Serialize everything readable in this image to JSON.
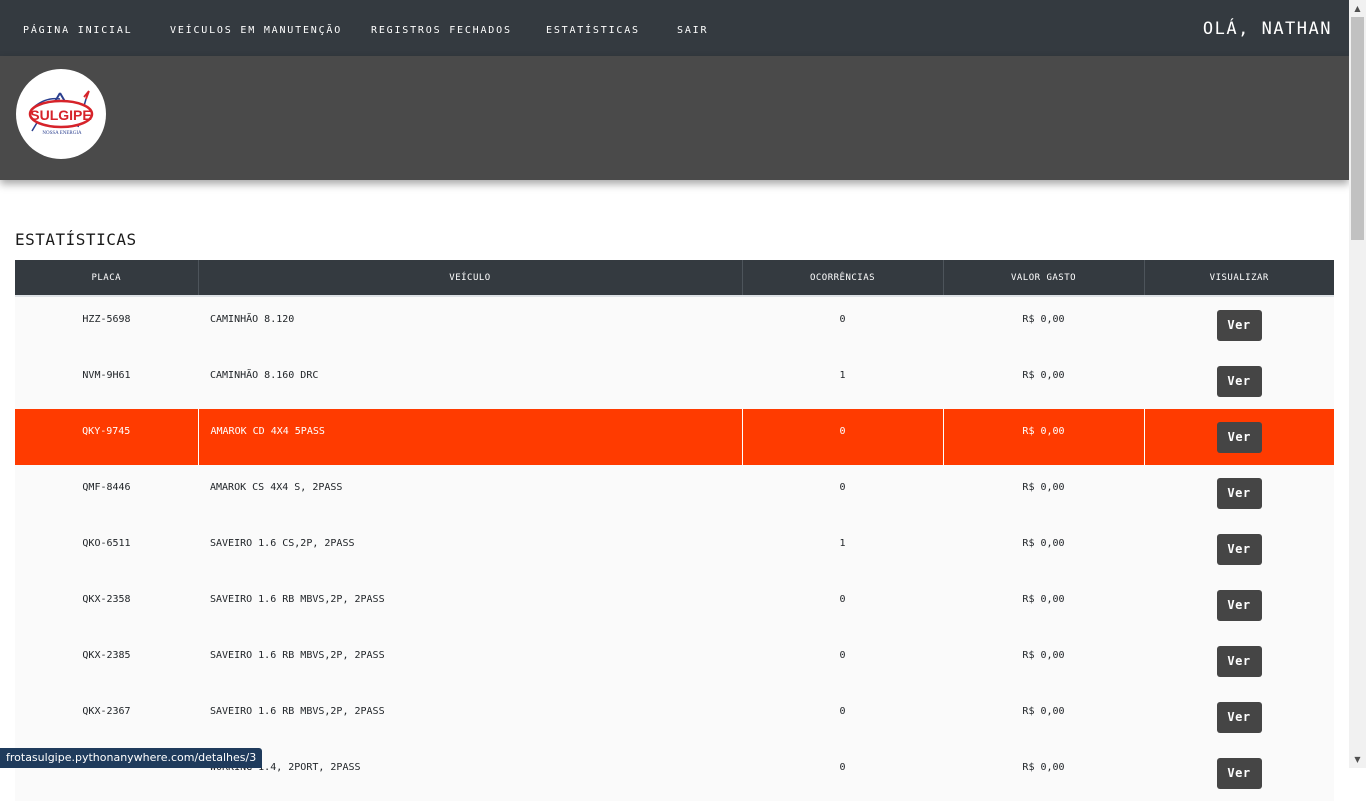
{
  "nav": {
    "items": [
      {
        "label": "PÁGINA INICIAL"
      },
      {
        "label": "VEÍCULOS EM MANUTENÇÃO"
      },
      {
        "label": "REGISTROS FECHADOS"
      },
      {
        "label": "ESTATÍSTICAS"
      },
      {
        "label": "SAIR"
      }
    ],
    "greeting": "OLÁ, NATHAN"
  },
  "logo": {
    "text": "SULGIPE",
    "tagline": "NOSSA ENERGIA",
    "colors": {
      "red": "#d6232a",
      "blue": "#2a3f8f"
    }
  },
  "page": {
    "title": "ESTATÍSTICAS"
  },
  "table": {
    "headers": [
      "PLACA",
      "VEÍCULO",
      "OCORRÊNCIAS",
      "VALOR GASTO",
      "VISUALIZAR"
    ],
    "highlight_color": "#ff3b00",
    "rows": [
      {
        "placa": "HZZ-5698",
        "veiculo": "CAMINHÃO 8.120",
        "ocorrencias": "0",
        "valor": "R$ 0,00",
        "action": "Ver"
      },
      {
        "placa": "NVM-9H61",
        "veiculo": "CAMINHÃO 8.160 DRC",
        "ocorrencias": "1",
        "valor": "R$ 0,00",
        "action": "Ver"
      },
      {
        "placa": "QKY-9745",
        "veiculo": "AMAROK CD 4X4 5PASS",
        "ocorrencias": "0",
        "valor": "R$ 0,00",
        "action": "Ver"
      },
      {
        "placa": "QMF-8446",
        "veiculo": "AMAROK CS 4X4 S, 2PASS",
        "ocorrencias": "0",
        "valor": "R$ 0,00",
        "action": "Ver"
      },
      {
        "placa": "QKO-6511",
        "veiculo": "SAVEIRO 1.6 CS,2P, 2PASS",
        "ocorrencias": "1",
        "valor": "R$ 0,00",
        "action": "Ver"
      },
      {
        "placa": "QKX-2358",
        "veiculo": "SAVEIRO 1.6 RB MBVS,2P, 2PASS",
        "ocorrencias": "0",
        "valor": "R$ 0,00",
        "action": "Ver"
      },
      {
        "placa": "QKX-2385",
        "veiculo": "SAVEIRO 1.6 RB MBVS,2P, 2PASS",
        "ocorrencias": "0",
        "valor": "R$ 0,00",
        "action": "Ver"
      },
      {
        "placa": "QKX-2367",
        "veiculo": "SAVEIRO 1.6 RB MBVS,2P, 2PASS",
        "ocorrencias": "0",
        "valor": "R$ 0,00",
        "action": "Ver"
      },
      {
        "placa": "",
        "veiculo": "WORKING 1.4, 2PORT, 2PASS",
        "ocorrencias": "0",
        "valor": "R$ 0,00",
        "action": "Ver"
      }
    ]
  },
  "statusbar": {
    "url": "frotasulgipe.pythonanywhere.com/detalhes/3"
  }
}
